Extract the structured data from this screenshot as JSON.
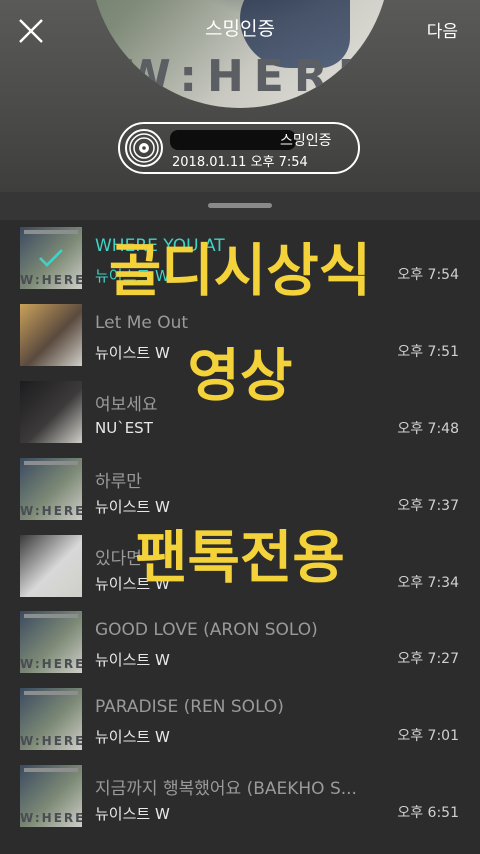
{
  "header": {
    "title": "스밍인증",
    "next_label": "다음",
    "art_text": "W:HERE",
    "pill": {
      "label": "스밍인증",
      "timestamp": "2018.01.11 오후 7:54"
    }
  },
  "tracks": [
    {
      "title": "WHERE YOU AT",
      "artist": "뉴이스트 W",
      "time": "오후 7:54",
      "active": true,
      "thumb": {
        "bg": "#7d8a76",
        "accent": "#3a4a60",
        "word": "W:HERE"
      }
    },
    {
      "title": "Let Me Out",
      "artist": "뉴이스트 W",
      "time": "오후 7:51",
      "active": false,
      "thumb": {
        "bg": "#5a4a3e",
        "accent": "#caa15a",
        "word": ""
      }
    },
    {
      "title": "여보세요",
      "artist": "NU`EST",
      "time": "오후 7:48",
      "active": false,
      "thumb": {
        "bg": "#3c3a3a",
        "accent": "#1c1c1e",
        "word": ""
      }
    },
    {
      "title": "하루만",
      "artist": "뉴이스트 W",
      "time": "오후 7:37",
      "active": false,
      "thumb": {
        "bg": "#7d8a76",
        "accent": "#3a4a60",
        "word": "W:HERE"
      }
    },
    {
      "title": "있다면",
      "artist": "뉴이스트 W",
      "time": "오후 7:34",
      "active": false,
      "thumb": {
        "bg": "#d8d8d8",
        "accent": "#3a3a3a",
        "word": ""
      }
    },
    {
      "title": "GOOD LOVE (ARON SOLO)",
      "artist": "뉴이스트 W",
      "time": "오후 7:27",
      "active": false,
      "thumb": {
        "bg": "#7d8a76",
        "accent": "#3a4a60",
        "word": "W:HERE"
      }
    },
    {
      "title": "PARADISE (REN SOLO)",
      "artist": "뉴이스트 W",
      "time": "오후 7:01",
      "active": false,
      "thumb": {
        "bg": "#7d8a76",
        "accent": "#3a4a60",
        "word": "W:HERE"
      }
    },
    {
      "title": "지금까지 행복했어요 (BAEKHO S...",
      "artist": "뉴이스트 W",
      "time": "오후 6:51",
      "active": false,
      "thumb": {
        "bg": "#7d8a76",
        "accent": "#3a4a60",
        "word": "W:HERE"
      }
    }
  ],
  "overlay_text": {
    "line1": "골디시상식",
    "line2": "영상",
    "line3": "팬톡전용"
  },
  "colors": {
    "accent_teal": "#3fd3c6",
    "overlay_yellow": "#f3d23a"
  }
}
